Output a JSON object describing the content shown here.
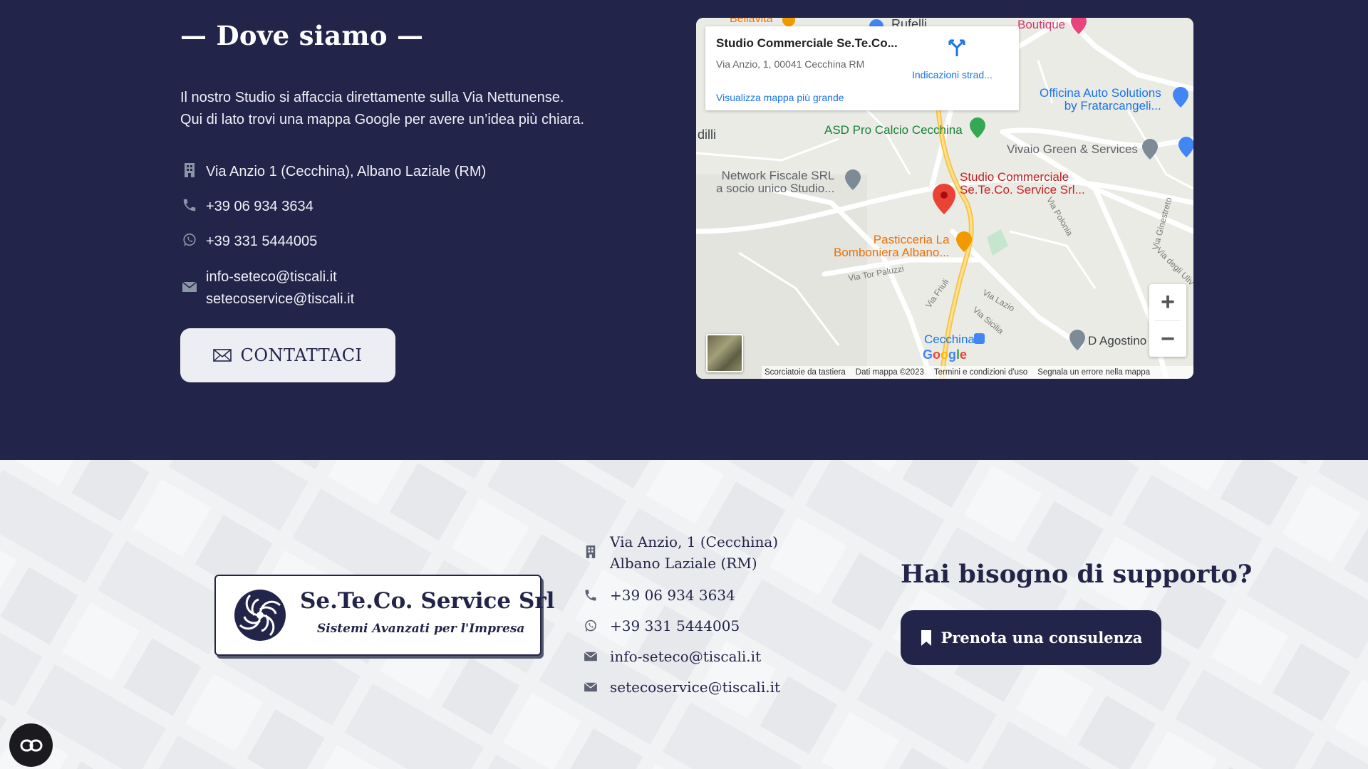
{
  "section": {
    "title": "— Dove siamo —",
    "intro_line1": "Il nostro Studio si affaccia direttamente sulla Via Nettunense.",
    "intro_line2": "Qui di lato trovi una mappa Google per avere un’idea più chiara."
  },
  "contact": {
    "address": "Via Anzio 1 (Cecchina), Albano Laziale (RM)",
    "phone": "+39 06 934 3634",
    "whatsapp": "+39 331 5444005",
    "email1": "info-seteco@tiscali.it",
    "email2": "setecoservice@tiscali.it",
    "button_label": "CONTATTACI"
  },
  "map": {
    "card_name": "Studio Commerciale Se.Te.Co...",
    "card_address": "Via Anzio, 1, 00041 Cecchina RM",
    "directions_label": "Indicazioni strad...",
    "larger_map_label": "Visualizza mappa più grande",
    "zoom_in": "+",
    "zoom_out": "−",
    "pois": {
      "bellavita": "Bellavita",
      "rufelli": "Rufelli",
      "boutique": "Boutique",
      "officina_l1": "Officina Auto Solutions",
      "officina_l2": "by Fratarcangeli...",
      "asd": "ASD Pro Calcio Cecchina",
      "dilli": "dilli",
      "vivaio": "Vivaio Green & Services",
      "network_l1": "Network Fiscale SRL",
      "network_l2": "a socio unico Studio...",
      "studio_l1": "Studio Commerciale",
      "studio_l2": "Se.Te.Co. Service Srl...",
      "pasticceria_l1": "Pasticceria La",
      "pasticceria_l2": "Bomboniera Albano...",
      "cecchina": "Cecchina",
      "dagostino": "D Agostino",
      "via_polonia": "Via Polonia",
      "via_ginestreto": "Via Ginestreto",
      "via_degli_ulivi": "Via degli Uliv",
      "via_tor_paluzzi": "Via Tor Paluzzi",
      "via_friuli": "Via Friuli",
      "via_lazio": "Via Lazio",
      "via_sicilia": "Via Sicilia"
    },
    "google": "Google",
    "attribution": [
      "Scorciatoie da tastiera",
      "Dati mappa ©2023",
      "Termini e condizioni d'uso",
      "Segnala un errore nella mappa"
    ]
  },
  "footer": {
    "logo_name": "Se.Te.Co. Service Srl",
    "logo_tagline": "Sistemi Avanzati per l'Impresa",
    "address_line1": "Via Anzio, 1 (Cecchina)",
    "address_line2": "Albano Laziale (RM)",
    "phone": "+39 06 934 3634",
    "whatsapp": "+39 331 5444005",
    "email1": "info-seteco@tiscali.it",
    "email2": "setecoservice@tiscali.it",
    "support_title": "Hai bisogno di supporto?",
    "book_button": "Prenota una consulenza"
  },
  "colors": {
    "navy": "#232449",
    "map_pin": "#ea4335",
    "link_blue": "#1a73e8"
  }
}
